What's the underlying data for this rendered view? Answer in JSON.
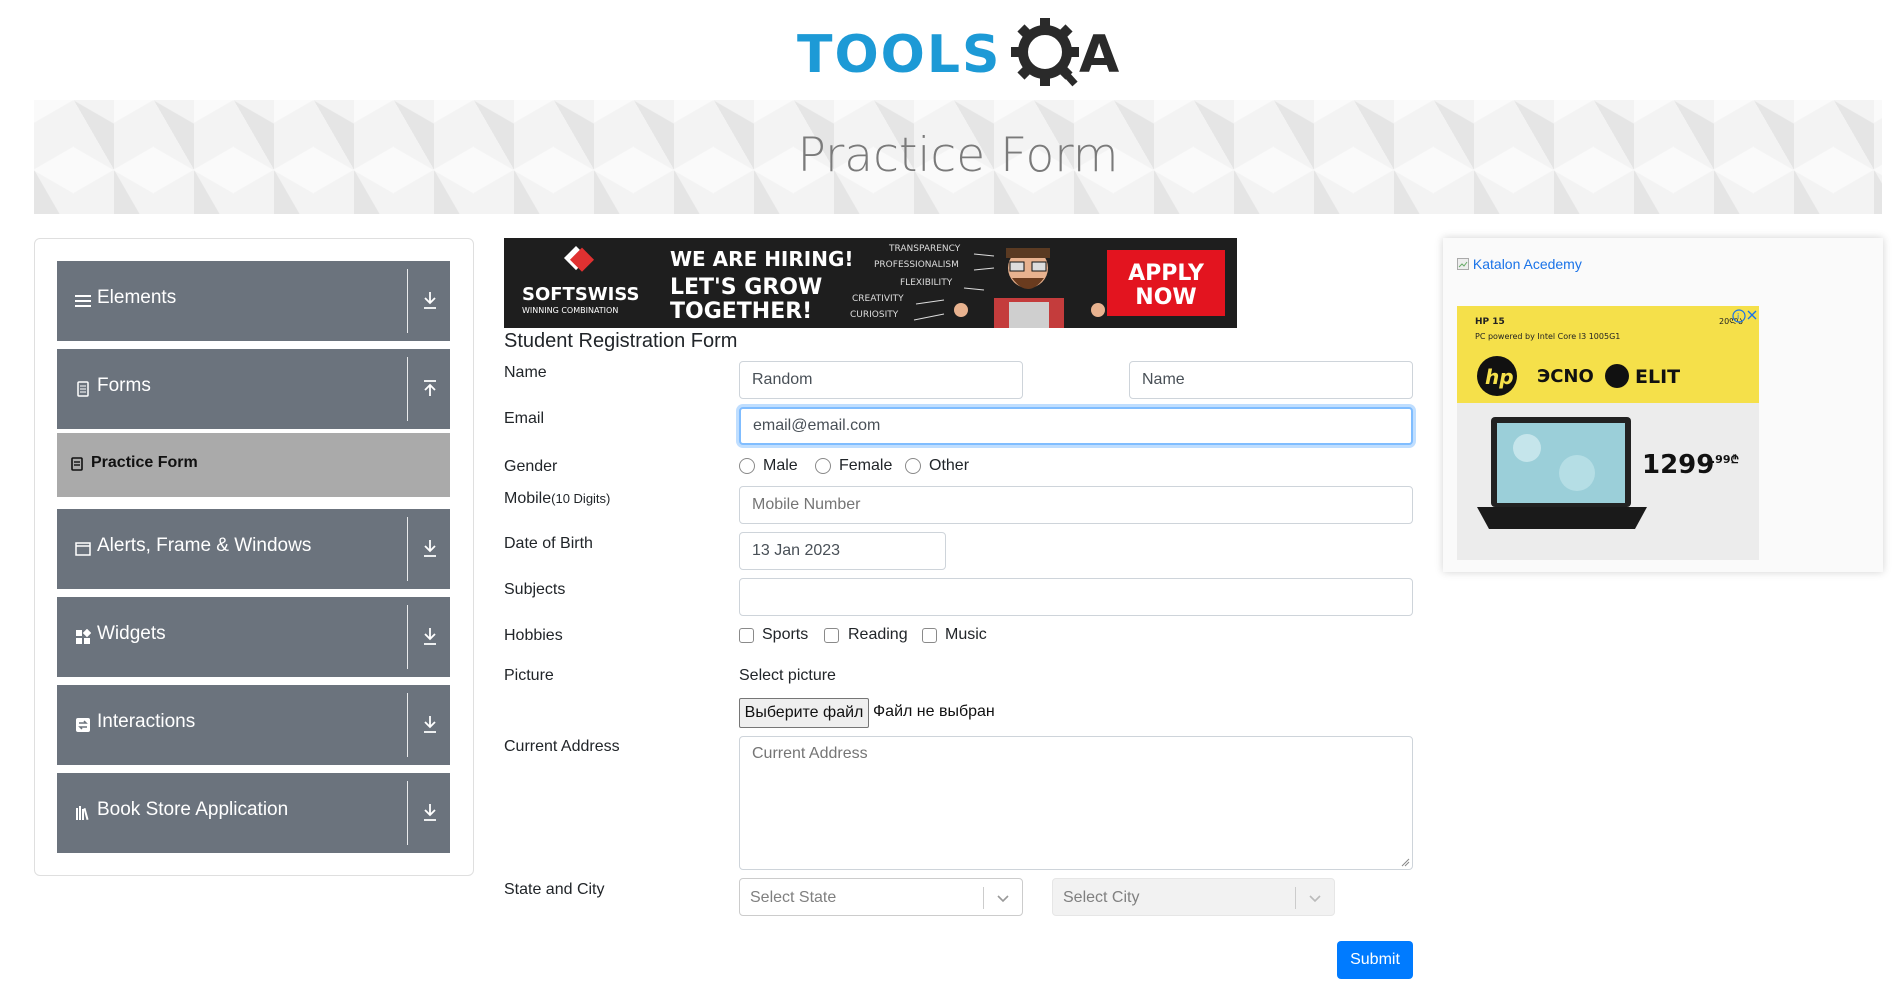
{
  "header": {
    "logo_text_1": "TOOLS",
    "logo_text_2": "QA",
    "page_title": "Practice Form"
  },
  "sidebar": {
    "groups": [
      {
        "label": "Elements",
        "icon": "hamburger-icon",
        "arrow": "download-arrow-icon"
      },
      {
        "label": "Forms",
        "icon": "document-icon",
        "arrow": "upload-arrow-icon"
      },
      {
        "label": "Alerts, Frame & Windows",
        "icon": "window-icon",
        "arrow": "download-arrow-icon"
      },
      {
        "label": "Widgets",
        "icon": "widgets-icon",
        "arrow": "download-arrow-icon"
      },
      {
        "label": "Interactions",
        "icon": "interactions-icon",
        "arrow": "download-arrow-icon"
      },
      {
        "label": "Book Store Application",
        "icon": "books-icon",
        "arrow": "download-arrow-icon"
      }
    ],
    "active_item": "Practice Form"
  },
  "ad_top": {
    "brand": "SOFTSWISS",
    "brand_sub": "WINNING COMBINATION",
    "headline_1": "WE ARE HIRING!",
    "headline_2": "LET'S GROW",
    "headline_3": "TOGETHER!",
    "values": [
      "TRANSPARENCY",
      "PROFESSIONALISM",
      "FLEXIBILITY",
      "CREATIVITY",
      "CURIOSITY"
    ],
    "cta_1": "APPLY",
    "cta_2": "NOW"
  },
  "form": {
    "title": "Student Registration Form",
    "name_label": "Name",
    "first_name_value": "Random",
    "last_name_value": "Name",
    "email_label": "Email",
    "email_value": "email@email.com",
    "gender_label": "Gender",
    "gender_options": [
      "Male",
      "Female",
      "Other"
    ],
    "mobile_label": "Mobile",
    "mobile_hint": "(10 Digits)",
    "mobile_placeholder": "Mobile Number",
    "dob_label": "Date of Birth",
    "dob_value": "13 Jan 2023",
    "subjects_label": "Subjects",
    "subjects_value": "",
    "hobbies_label": "Hobbies",
    "hobbies_options": [
      "Sports",
      "Reading",
      "Music"
    ],
    "picture_label": "Picture",
    "picture_select_text": "Select picture",
    "file_button": "Выберите файл",
    "file_status": "Файл не выбран",
    "address_label": "Current Address",
    "address_placeholder": "Current Address",
    "state_city_label": "State and City",
    "state_placeholder": "Select State",
    "city_placeholder": "Select City",
    "submit_label": "Submit"
  },
  "ad_right": {
    "katalon_alt": "Katalon Acedemy",
    "hp_model": "HP 15",
    "hp_spec": "PC powered by Intel Core I3 1005G1",
    "hp_corner": "20ᲚᲐ",
    "store_1": "ЭCNO",
    "store_2": "ELIT",
    "price": "1299",
    "price_cents": ".99₾"
  },
  "colors": {
    "sidebar_group": "#6b737d",
    "active_item": "#aaaaaa",
    "submit": "#007bff",
    "logo_blue": "#1d9ad6",
    "logo_dark": "#2a2a2a"
  }
}
